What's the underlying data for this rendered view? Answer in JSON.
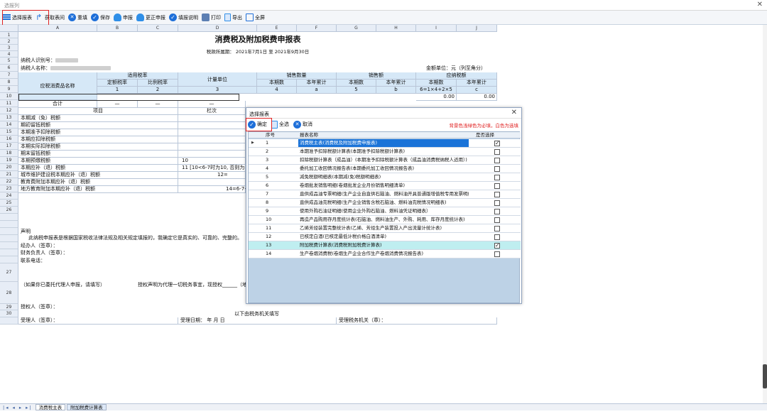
{
  "window": {
    "title": "选报列"
  },
  "toolbar": {
    "items": [
      {
        "id": "select",
        "label": "选择报表",
        "icon": "list-icon"
      },
      {
        "id": "fetch",
        "label": "获取表间",
        "icon": "arrow-icon"
      },
      {
        "id": "refill",
        "label": "重填",
        "icon": "x-circle-icon"
      },
      {
        "id": "save",
        "label": "保存",
        "icon": "check-circle-icon"
      },
      {
        "id": "submit",
        "label": "申报",
        "icon": "cloud-icon"
      },
      {
        "id": "correct",
        "label": "更正申报",
        "icon": "cloud-icon"
      },
      {
        "id": "guide",
        "label": "填报说明",
        "icon": "check-circle-icon"
      },
      {
        "id": "print",
        "label": "打印",
        "icon": "print-icon"
      },
      {
        "id": "export",
        "label": "导出",
        "icon": "doc-icon"
      },
      {
        "id": "fullscreen",
        "label": "全屏",
        "icon": "fullscreen-icon"
      }
    ]
  },
  "sheet": {
    "columns": [
      "A",
      "B",
      "C",
      "D",
      "E",
      "F",
      "G",
      "H",
      "I",
      "J"
    ],
    "title": "消费税及附加税费申报表",
    "period": "税款所属期：  2021年7月1日  至  2021年9月30日",
    "taxpayer_id_label": "纳税人识别号：",
    "taxpayer_name_label": "纳税人名称：",
    "amount_unit": "金额单位：元（列至角分）",
    "headers": {
      "item_name": "应税消费品名称",
      "rate": "适用税率",
      "rate_fixed": "定额税率",
      "rate_ratio": "比例税率",
      "unit": "计量单位",
      "qty": "销售数量",
      "amount": "销售额",
      "tax": "应纳税额",
      "current": "本期数",
      "ytd": "本年累计",
      "n1": "1",
      "n2": "2",
      "n3": "3",
      "n4": "4",
      "na": "a",
      "n5": "5",
      "nb": "b",
      "formula": "6=1×4+2×5",
      "nc": "c"
    },
    "row8_values": [
      "0.00",
      "0.00"
    ],
    "total_label": "合计",
    "dash": "—",
    "item_col": "项目",
    "lane_col": "栏次",
    "rows": [
      "本期减（免）税额",
      "期初留抵税额",
      "本期准予扣除税额",
      "本期应扣除税额",
      "本期实际扣除税额",
      "期末留抵税额",
      "本期预缴税额",
      "本期应补（退）税额",
      "城市维护建设税本期应补（退）税额",
      "教育费附加本期应补（退）税额",
      "地方教育附加本期应补（退）税额"
    ],
    "row_lanes": {
      "r14": "10",
      "r15": "11 [10<6-7时为10, 否则为",
      "r16": "12=",
      "r18": "14=6-7-1"
    },
    "declare_label": "声明",
    "declare_text": "此纳税申报表是根据国家税收法律法规及相关规定填报的，我确定它是真实的、可靠的、完整的。",
    "operator": "经办人（签章）：",
    "finance": "财务负责人（签章）：",
    "contact": "联系电话：",
    "agent_note": "（如果你已委托代理人申报，请填写）",
    "auth_note": "授权声明为代理一切税务事宜，现授权______（地",
    "authorized": "授权人（签章）：",
    "tax_office_fill": "以下由税务机关填写",
    "receiver": "受理人（签章）：",
    "receive_date": "受理日期：     年     月     日",
    "receive_office": "受理税务机关（章）："
  },
  "tabs": [
    {
      "label": "消费税主表",
      "active": false
    },
    {
      "label": "附加税费计算表",
      "active": true
    }
  ],
  "dialog": {
    "title": "选择报表",
    "confirm": "确定",
    "select_all": "全选",
    "cancel": "取消",
    "hint": "背景色浅绿色为必填，白色为选填",
    "col_seq": "序号",
    "col_name": "报表名称",
    "col_select": "是否选择",
    "rows": [
      {
        "seq": "1",
        "name": "消费税主表(消费税及附加税费申报表)",
        "checked": true,
        "state": "selected"
      },
      {
        "seq": "2",
        "name": "本期准予扣除税额计算表(本期准予扣除税额计算表)",
        "checked": false,
        "state": ""
      },
      {
        "seq": "3",
        "name": "扣除税额计算表（成品油）(本期准予扣除税额计算表（成品油消费税纳税人适用）)",
        "checked": false,
        "state": ""
      },
      {
        "seq": "4",
        "name": "委托加工收回情况报告表(本期委托加工收回情况报告表)",
        "checked": false,
        "state": ""
      },
      {
        "seq": "5",
        "name": "减免税额明细表(本期减(免)税额明细表)",
        "checked": false,
        "state": ""
      },
      {
        "seq": "6",
        "name": "卷烟批发销售明细(卷烟批发企业月份销售明细清单)",
        "checked": false,
        "state": ""
      },
      {
        "seq": "7",
        "name": "直供成品油专票明细(生产企业自直供石脑油、燃料油开具普通版增值税专用发票明细表)",
        "checked": false,
        "state": ""
      },
      {
        "seq": "8",
        "name": "直供成品油完税明细(生产企业销售含税石脑油、燃料油完税情况明细表)",
        "checked": false,
        "state": ""
      },
      {
        "seq": "9",
        "name": "使用外购石油证明细(使用企业外购石脑油、燃料油凭证明细表）",
        "checked": false,
        "state": ""
      },
      {
        "seq": "10",
        "name": "再造产品购用存月度统计表(石脑油、燃料油生产、外购、耗用、库存月度统计表)",
        "checked": false,
        "state": ""
      },
      {
        "seq": "11",
        "name": "乙烯芳烃装置完整统计表(乙烯、芳烃生产装置投入产出流量计统计表)",
        "checked": false,
        "state": ""
      },
      {
        "seq": "12",
        "name": "已核定白酒(已核定最低计税价格白酒清单)",
        "checked": false,
        "state": ""
      },
      {
        "seq": "13",
        "name": "附加税费计算表(消费税附加税费计算表)",
        "checked": true,
        "state": "green"
      },
      {
        "seq": "14",
        "name": "生产卷烟消费税(卷烟生产企业合作生产卷烟消费情况报告表)",
        "checked": false,
        "state": ""
      }
    ]
  }
}
